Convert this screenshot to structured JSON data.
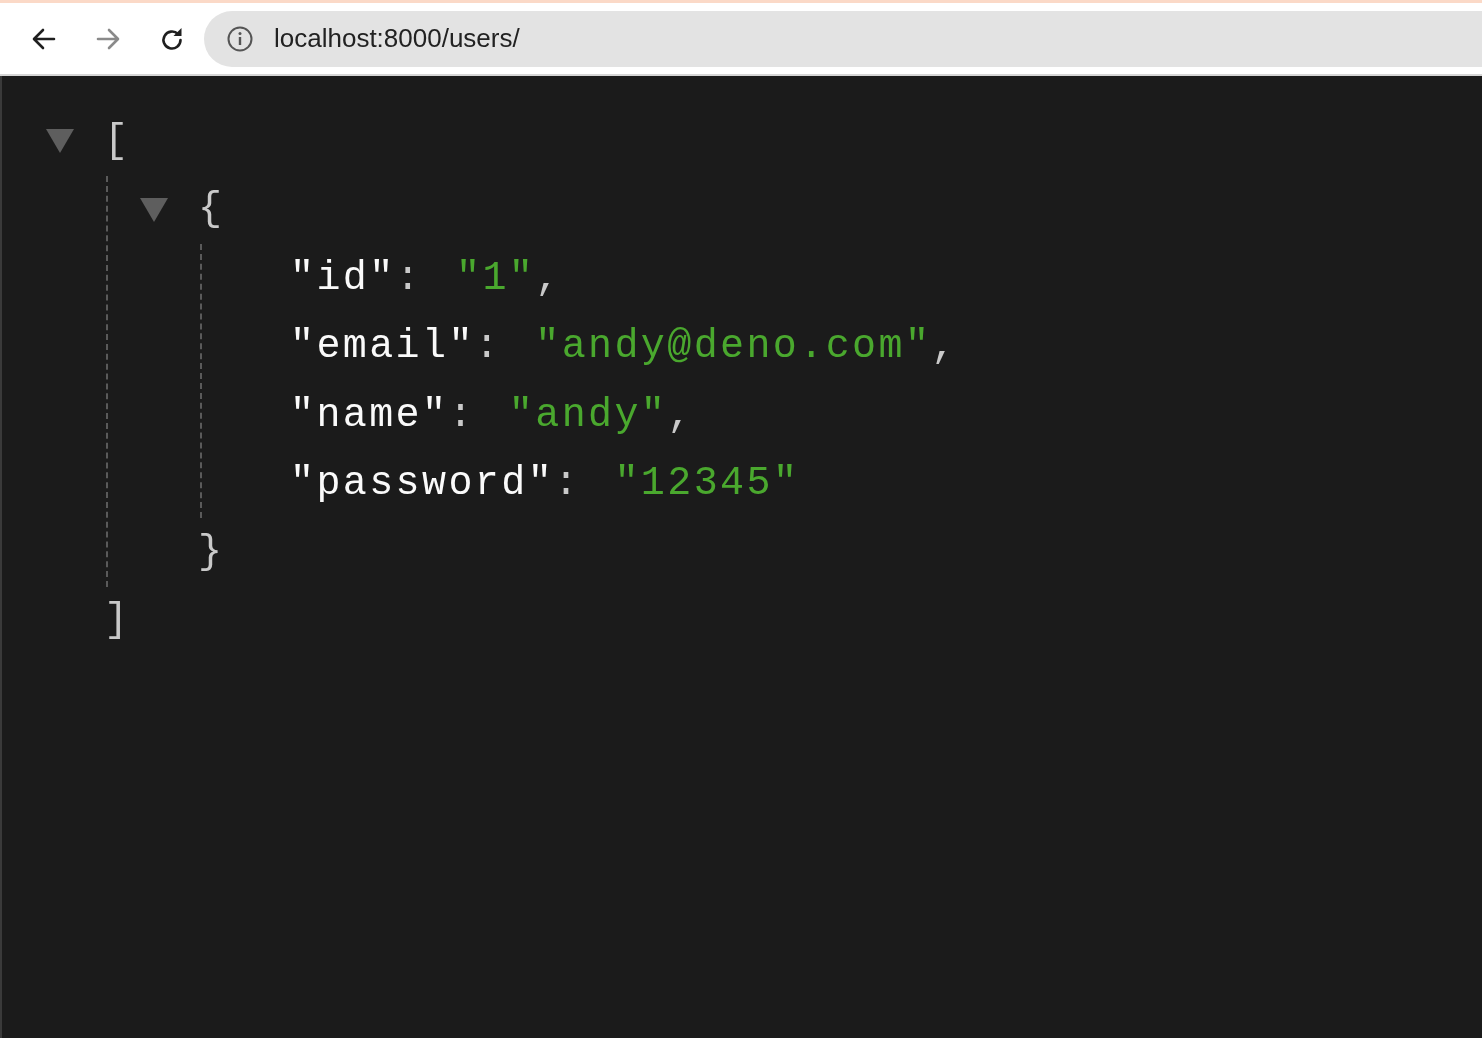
{
  "browser": {
    "back_enabled": true,
    "forward_enabled": false,
    "address": "localhost:8000/users/"
  },
  "viewer": {
    "root": {
      "kind": "array",
      "open": "[",
      "close": "]",
      "expanded": true,
      "children": [
        {
          "kind": "object",
          "open": "{",
          "close": "}",
          "expanded": true,
          "entries": [
            {
              "key": "\"id\"",
              "separator": ":",
              "value": "\"1\"",
              "comma": ","
            },
            {
              "key": "\"email\"",
              "separator": ":",
              "value": "\"andy@deno.com\"",
              "comma": ","
            },
            {
              "key": "\"name\"",
              "separator": ":",
              "value": "\"andy\"",
              "comma": ","
            },
            {
              "key": "\"password\"",
              "separator": ":",
              "value": "\"12345\""
            }
          ]
        }
      ]
    }
  }
}
